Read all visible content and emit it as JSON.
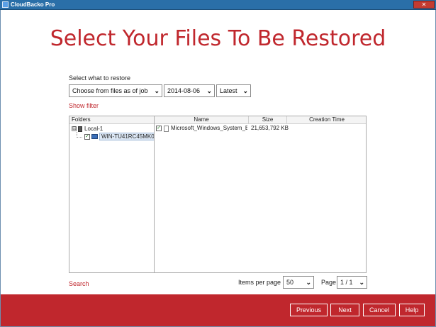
{
  "window": {
    "title": "CloudBacko Pro",
    "close_label": "✕"
  },
  "header": {
    "title": "Select Your Files To Be Restored"
  },
  "restore": {
    "label": "Select what to restore",
    "mode_value": "Choose from files as of job",
    "date_value": "2014-08-06",
    "version_value": "Latest"
  },
  "filter": {
    "show_filter_label": "Show filter"
  },
  "folders": {
    "header": "Folders",
    "tree": [
      {
        "label": "Local-1",
        "level": 0,
        "expander": "⊟"
      },
      {
        "label": "WIN-TU41RC45MK0",
        "level": 1,
        "checked": "✓",
        "selected": true
      }
    ]
  },
  "files": {
    "columns": {
      "name": "Name",
      "size": "Size",
      "creation_time": "Creation Time"
    },
    "rows": [
      {
        "checked": "✓",
        "name": "Microsoft_Windows_System_B...",
        "size": "21,653,792 KB",
        "creation_time": ""
      }
    ]
  },
  "search": {
    "label": "Search"
  },
  "pagination": {
    "items_per_page_label": "Items per page",
    "items_per_page_value": "50",
    "page_label": "Page",
    "page_value": "1 / 1"
  },
  "footer": {
    "previous_label": "Previous",
    "next_label": "Next",
    "cancel_label": "Cancel",
    "help_label": "Help"
  },
  "colors": {
    "accent": "#c0272d",
    "titlebar": "#2a6fa8"
  },
  "icons": {
    "dropdown": "chevron-down-icon",
    "drive": "drive-icon",
    "computer": "computer-icon",
    "file": "file-icon"
  }
}
